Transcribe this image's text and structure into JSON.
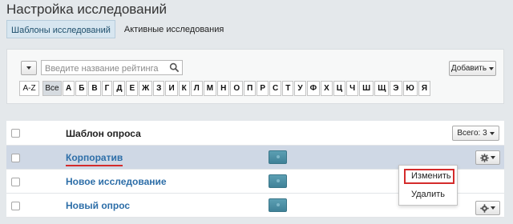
{
  "page": {
    "title": "Настройка исследований"
  },
  "tabs": [
    {
      "label": "Шаблоны исследований",
      "active": true
    },
    {
      "label": "Активные исследования",
      "active": false
    }
  ],
  "filter": {
    "search_placeholder": "Введите название рейтинга",
    "search_icon": "magnifier",
    "add_button_label": "Добавить",
    "alphabet": [
      "A-Z",
      "Все",
      "А",
      "Б",
      "В",
      "Г",
      "Д",
      "Е",
      "Ж",
      "З",
      "И",
      "К",
      "Л",
      "М",
      "Н",
      "О",
      "П",
      "Р",
      "С",
      "Т",
      "У",
      "Ф",
      "Х",
      "Ц",
      "Ч",
      "Ш",
      "Щ",
      "Э",
      "Ю",
      "Я"
    ]
  },
  "table": {
    "header_label": "Шаблон опроса",
    "total_label": "Всего: 3",
    "rows": [
      {
        "name": "Корпоратив",
        "selected": true
      },
      {
        "name": "Новое исследование",
        "selected": false
      },
      {
        "name": "Новый опрос",
        "selected": false
      }
    ]
  },
  "context_menu": {
    "items": [
      "Изменить",
      "Удалить"
    ],
    "highlighted": "Изменить"
  },
  "colors": {
    "background": "#e4e8eb",
    "link": "#2d6ea8",
    "highlight_red": "#d42b2b",
    "selected_row": "#cfd8e5",
    "action_button": "#4a8ca1"
  }
}
